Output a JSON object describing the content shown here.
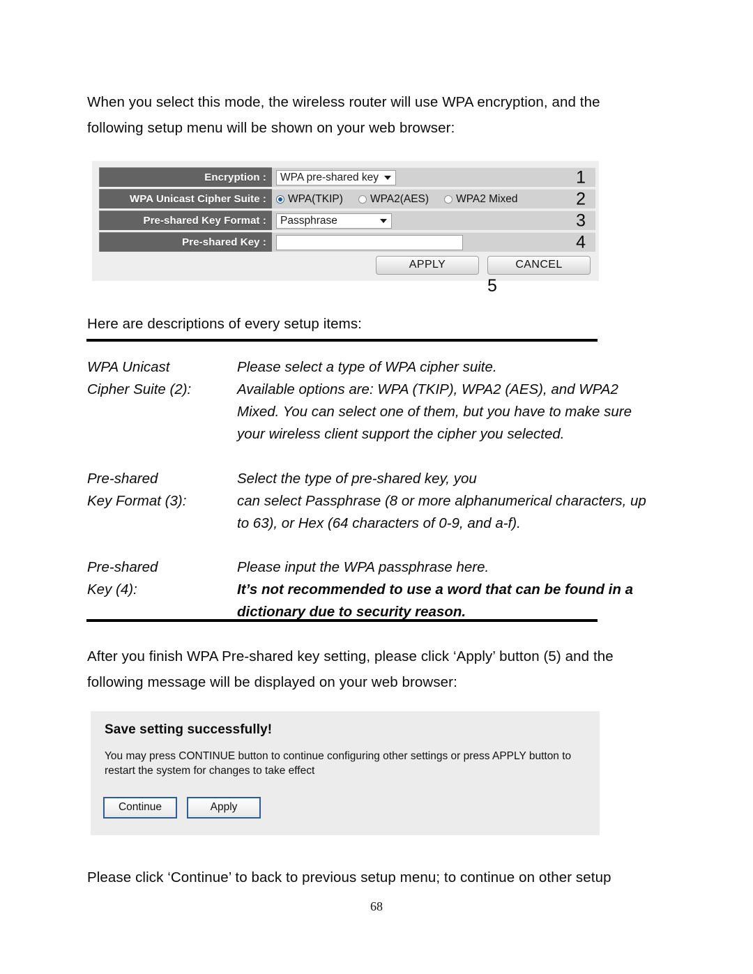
{
  "document": {
    "page_number": "68",
    "intro_paragraph": "When you select this mode, the wireless router will use WPA encryption, and the following setup menu will be shown on your web browser:",
    "descriptions_heading": "Here are descriptions of every setup items:",
    "apply_paragraph": "After you finish WPA Pre-shared key setting, please click ‘Apply’ button (5) and the following message will be displayed on your web browser:",
    "continue_paragraph": "Please click ‘Continue’ to back to previous setup menu; to continue on other setup"
  },
  "router_panel": {
    "rows": [
      {
        "label": "Encryption :",
        "control": "select",
        "value": "WPA pre-shared key",
        "marker": "1"
      },
      {
        "label": "WPA Unicast Cipher Suite :",
        "control": "radio",
        "options": [
          {
            "label": "WPA(TKIP)",
            "selected": true
          },
          {
            "label": "WPA2(AES)",
            "selected": false
          },
          {
            "label": "WPA2 Mixed",
            "selected": false
          }
        ],
        "marker": "2"
      },
      {
        "label": "Pre-shared Key Format :",
        "control": "select",
        "value": "Passphrase",
        "marker": "3"
      },
      {
        "label": "Pre-shared Key :",
        "control": "text",
        "value": "",
        "marker": "4"
      }
    ],
    "apply_button": "APPLY",
    "cancel_button": "CANCEL",
    "button_marker": "5",
    "colors": {
      "panel_background": "#efeeee",
      "label_background": "#636363",
      "label_text": "#ffffff",
      "value_background": "#d2d2d2",
      "radio_selected": "#1559a8"
    }
  },
  "descriptions": [
    {
      "term_lines": [
        "WPA Unicast",
        "Cipher Suite (2):"
      ],
      "body_lines": [
        {
          "text": "Please select a type of WPA cipher suite.",
          "bold": false
        },
        {
          "text": "Available options are: WPA (TKIP), WPA2 (AES), and WPA2",
          "bold": false
        },
        {
          "text": "Mixed. You can select one of them, but you have to make sure",
          "bold": false
        },
        {
          "text": "your wireless client support the cipher you selected.",
          "bold": false
        }
      ]
    },
    {
      "term_lines": [
        "Pre-shared",
        "Key Format (3):"
      ],
      "body_lines": [
        {
          "text": "Select the type of pre-shared key, you",
          "bold": false
        },
        {
          "text": "can select Passphrase (8 or more alphanumerical characters, up",
          "bold": false
        },
        {
          "text": "to 63), or Hex (64 characters of 0-9, and a-f).",
          "bold": false
        }
      ]
    },
    {
      "term_lines": [
        "Pre-shared",
        "Key (4):"
      ],
      "body_lines": [
        {
          "text": "Please input the WPA passphrase here.",
          "bold": false
        },
        {
          "text": "It’s not recommended to use a word that can be found in a",
          "bold": true
        },
        {
          "text": "dictionary due to security reason.",
          "bold": true
        }
      ]
    }
  ],
  "save_panel": {
    "title": "Save setting successfully!",
    "message": "You may press CONTINUE button to continue configuring other settings or press APPLY button to restart the system for changes to take effect",
    "continue_button": "Continue",
    "apply_button": "Apply",
    "colors": {
      "panel_background": "#ececec",
      "button_border": "#2b5c9b"
    }
  }
}
